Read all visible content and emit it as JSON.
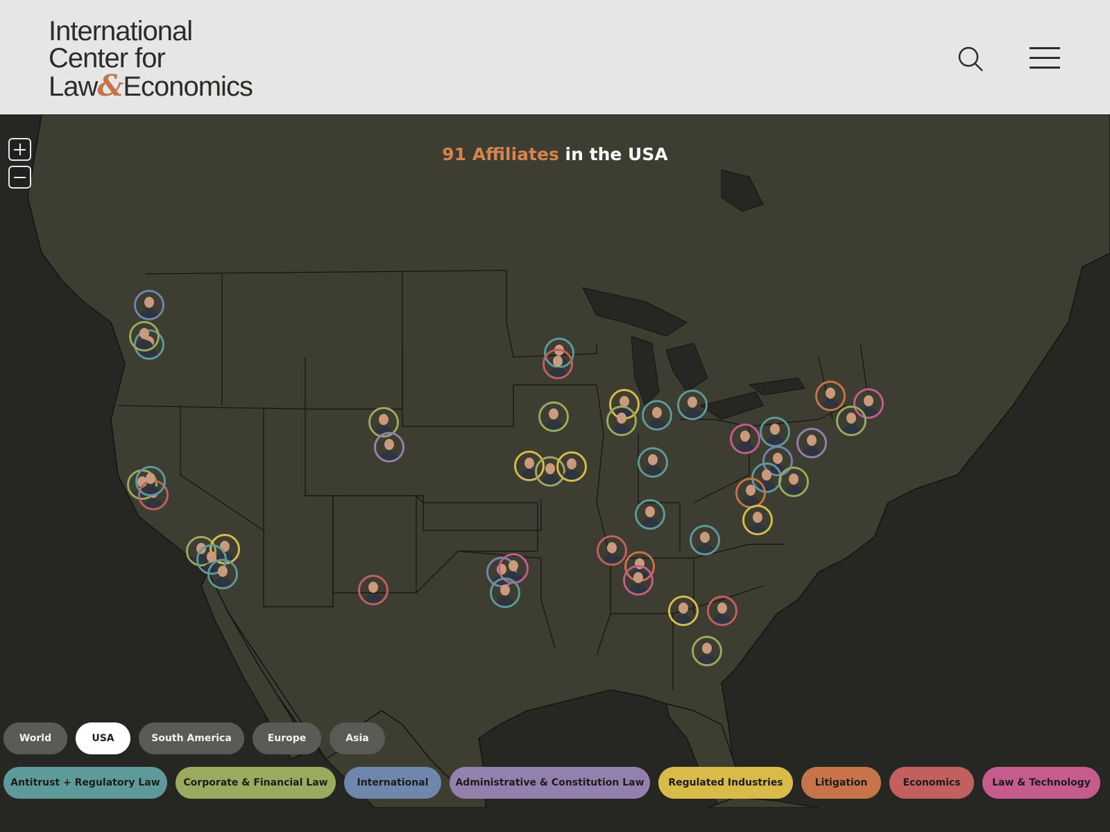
{
  "logo": {
    "line1": "International",
    "line2": "Center for",
    "line3a": "Law",
    "amp": "&",
    "line3b": "Economics"
  },
  "header": {
    "search_icon": "search-icon",
    "menu_icon": "hamburger-menu-icon"
  },
  "headline": {
    "count": "91",
    "accent_word": "Affiliates",
    "rest": " in the USA"
  },
  "zoom": {
    "in_icon": "plus-icon",
    "out_icon": "minus-icon"
  },
  "regions": [
    {
      "label": "World",
      "active": false
    },
    {
      "label": "USA",
      "active": true
    },
    {
      "label": "South America",
      "active": false
    },
    {
      "label": "Europe",
      "active": false
    },
    {
      "label": "Asia",
      "active": false
    }
  ],
  "categories": [
    {
      "label": "Antitrust + Regulatory Law",
      "color": "#5e9a9a"
    },
    {
      "label": "Corporate & Financial Law",
      "color": "#9aaa5e"
    },
    {
      "label": "International",
      "color": "#6f86ad"
    },
    {
      "label": "Administrative & Constitution Law",
      "color": "#9480ad"
    },
    {
      "label": "Regulated Industries",
      "color": "#d9bb4a"
    },
    {
      "label": "Litigation",
      "color": "#c8744a"
    },
    {
      "label": "Economics",
      "color": "#c2605f"
    },
    {
      "label": "Law & Technology",
      "color": "#c65c8e"
    }
  ],
  "colors": {
    "land": "#3d3d31",
    "water": "#262622",
    "accent": "#d4844f"
  }
}
